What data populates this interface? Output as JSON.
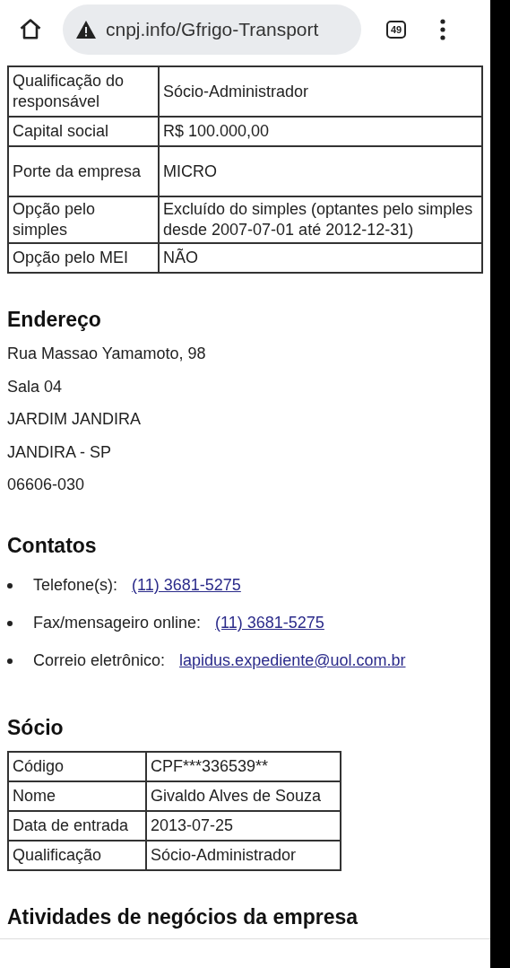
{
  "browser": {
    "url": "cnpj.info/Gfrigo-Transport",
    "tab_count": "49"
  },
  "company_table": [
    {
      "label": "Qualificação do responsável",
      "value": "Sócio-Administrador"
    },
    {
      "label": "Capital social",
      "value": "R$ 100.000,00"
    },
    {
      "label": "Porte da empresa",
      "value": "MICRO"
    },
    {
      "label": "Opção pelo simples",
      "value": "Excluído do simples (optantes pelo simples desde 2007-07-01 até 2012-12-31)"
    },
    {
      "label": "Opção pelo MEI",
      "value": "NÃO"
    }
  ],
  "address": {
    "title": "Endereço",
    "lines": [
      "Rua Massao Yamamoto, 98",
      "Sala 04",
      "JARDIM JANDIRA",
      "JANDIRA - SP",
      "06606-030"
    ]
  },
  "contacts": {
    "title": "Contatos",
    "items": [
      {
        "label": "Telefone(s):",
        "link": "(11) 3681-5275"
      },
      {
        "label": "Fax/mensageiro online:",
        "link": "(11) 3681-5275"
      },
      {
        "label": "Correio eletrônico:",
        "link": "lapidus.expediente@uol.com.br"
      }
    ]
  },
  "partner": {
    "title": "Sócio",
    "rows": [
      {
        "label": "Código",
        "value": "CPF***336539**"
      },
      {
        "label": "Nome",
        "value": "Givaldo Alves de Souza"
      },
      {
        "label": "Data de entrada",
        "value": "2013-07-25"
      },
      {
        "label": "Qualificação",
        "value": "Sócio-Administrador"
      }
    ]
  },
  "activities": {
    "title": "Atividades de negócios da empresa"
  }
}
